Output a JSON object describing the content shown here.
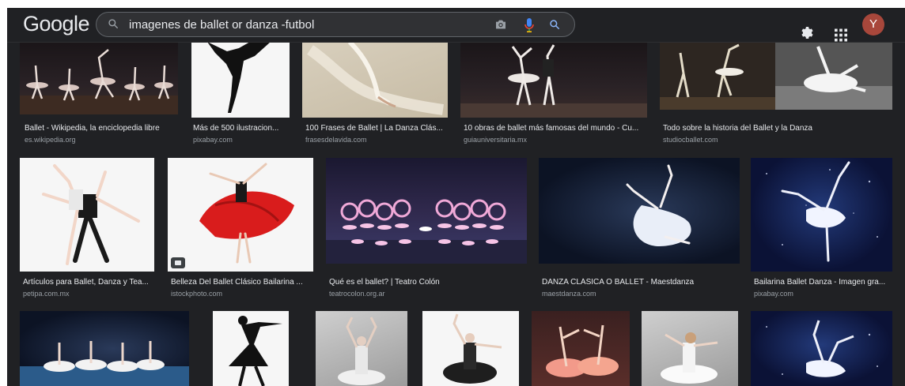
{
  "header": {
    "logo": "Google",
    "query": "imagenes de ballet or danza -futbol",
    "avatar_letter": "Y"
  },
  "icons": {
    "search": "search-icon",
    "camera": "camera-icon",
    "mic": "mic-icon",
    "search_button": "search-icon",
    "settings": "gear-icon",
    "apps": "apps-grid-icon"
  },
  "colors": {
    "background": "#202124",
    "text": "#e8eaed",
    "secondary_text": "#9aa0a6",
    "avatar": "#a8473b"
  },
  "results": [
    {
      "caption": "Ballet - Wikipedia, la enciclopedia libre",
      "source": "es.wikipedia.org"
    },
    {
      "caption": "Más de 500 ilustracion...",
      "source": "pixabay.com"
    },
    {
      "caption": "100 Frases de Ballet | La Danza Clás...",
      "source": "frasesdelavida.com"
    },
    {
      "caption": "10 obras de ballet más famosas del mundo - Cu...",
      "source": "guiauniversitaria.mx"
    },
    {
      "caption": "Todo sobre la historia del Ballet y la Danza",
      "source": "studiocballet.com"
    },
    {
      "caption": "Artículos para Ballet, Danza y Tea...",
      "source": "petipa.com.mx"
    },
    {
      "caption": "Belleza Del Ballet Clásico Bailarina ...",
      "source": "istockphoto.com"
    },
    {
      "caption": "Qué es el ballet? | Teatro Colón",
      "source": "teatrocolon.org.ar"
    },
    {
      "caption": "DANZA CLÁSICA O BALLET - Maestdanza",
      "source": "maestdanza.com"
    },
    {
      "caption": "Bailarina Ballet Danza - Imagen gra...",
      "source": "pixabay.com"
    }
  ]
}
